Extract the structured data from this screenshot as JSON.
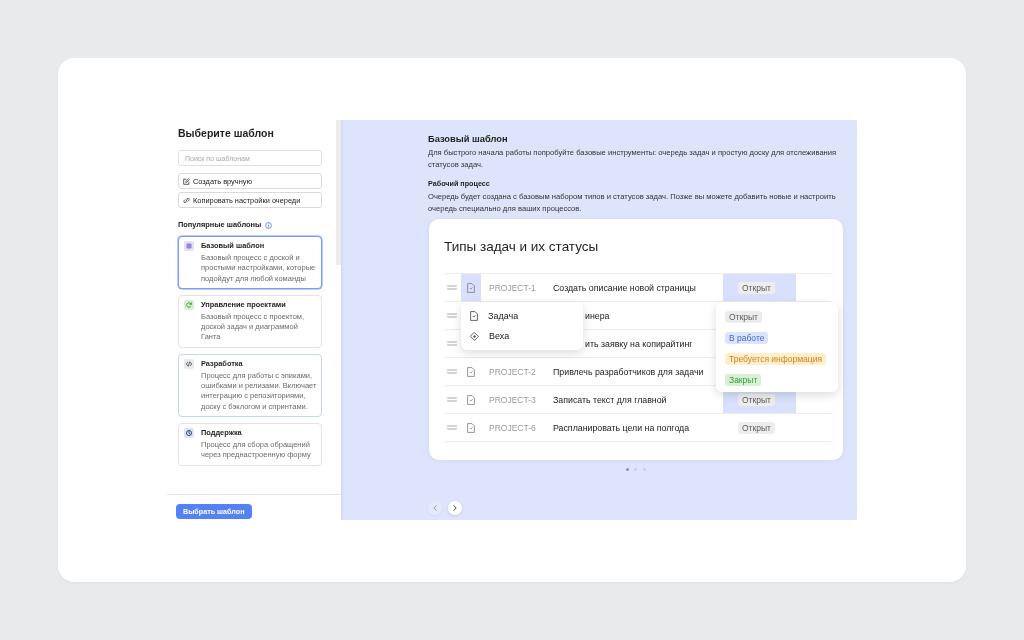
{
  "sidebar": {
    "title": "Выберите шаблон",
    "search": {
      "placeholder": "Поиск по шаблонам"
    },
    "actions": [
      {
        "kind": "create",
        "label": "Создать вручную"
      },
      {
        "kind": "copy",
        "label": "Копировать настройки очереди"
      }
    ],
    "section_title": "Популярные шаблоны",
    "templates": [
      {
        "kind": "grid",
        "color": "#e6ddf7",
        "title": "Базовый шаблон",
        "description": "Базовый процесс с доской и простыми настройками, которые подойдут для любой команды",
        "selected": true,
        "hovered": false
      },
      {
        "kind": "cycle",
        "color": "#d5efd1",
        "title": "Управление проектами",
        "description": "Базовый процесс с проектом, доской задач и диаграммой Ганта",
        "selected": false,
        "hovered": false
      },
      {
        "kind": "code",
        "color": "#e7e9ed",
        "title": "Разработка",
        "description": "Процесс для работы с эпиками, ошибками и релизами. Включает интеграцию с репозиториями, доску с бэклогом и спринтами.",
        "selected": false,
        "hovered": true
      },
      {
        "kind": "support",
        "color": "#dde4fa",
        "title": "Поддержка",
        "description": "Процесс для сбора обращений через преднастроенную форму",
        "selected": false,
        "hovered": false
      }
    ],
    "submit": "Выбрать шаблон"
  },
  "preview": {
    "title": "Базовый шаблон",
    "description": "Для быстрого начала работы попробуйте базовые инструменты: очередь задач и простую доску для отслеживания статусов задач.",
    "section_title": "Рабочий процесс",
    "section_text": "Очередь будет создана с базовым набором типов и статусов задач. Позже вы можете добавить новые и настроить очередь специально для ваших процессов.",
    "card": {
      "title": "Типы задач и их статусы",
      "rows": [
        {
          "key": "PROJECT-1",
          "title": "Создать описание новой страницы",
          "status": "Открыт",
          "type_active": true,
          "status_active": true
        },
        {
          "title": "инера"
        },
        {
          "title": "ить заявку на копирайтинг"
        },
        {
          "key": "PROJECT-2",
          "title": "Привлечь разработчиков для задачи",
          "type_active": false
        },
        {
          "key": "PROJECT-3",
          "title": "Записать текст для главной",
          "status": "Открыт",
          "type_active": false,
          "status_active": true
        },
        {
          "key": "PROJECT-6",
          "title": "Распланировать цели на полгода",
          "status": "Открыт",
          "type_active": false,
          "status_active": false
        }
      ],
      "type_menu": [
        {
          "kind": "task",
          "label": "Задача"
        },
        {
          "kind": "milestone",
          "label": "Веха"
        }
      ],
      "status_menu": [
        {
          "kind": "open",
          "label": "Открыт",
          "color": "#ececec"
        },
        {
          "kind": "progress",
          "label": "В работе",
          "color": "#dce4fb"
        },
        {
          "kind": "info",
          "label": "Требуется информация",
          "color": "#fdf0cb"
        },
        {
          "kind": "closed",
          "label": "Закрыт",
          "color": "#d9f0d7"
        }
      ]
    },
    "pages": [
      {
        "selected": true
      },
      {
        "selected": false
      },
      {
        "selected": false
      }
    ],
    "nav": [
      {
        "kind": "prev",
        "disabled": true
      },
      {
        "kind": "next",
        "disabled": false
      }
    ]
  }
}
